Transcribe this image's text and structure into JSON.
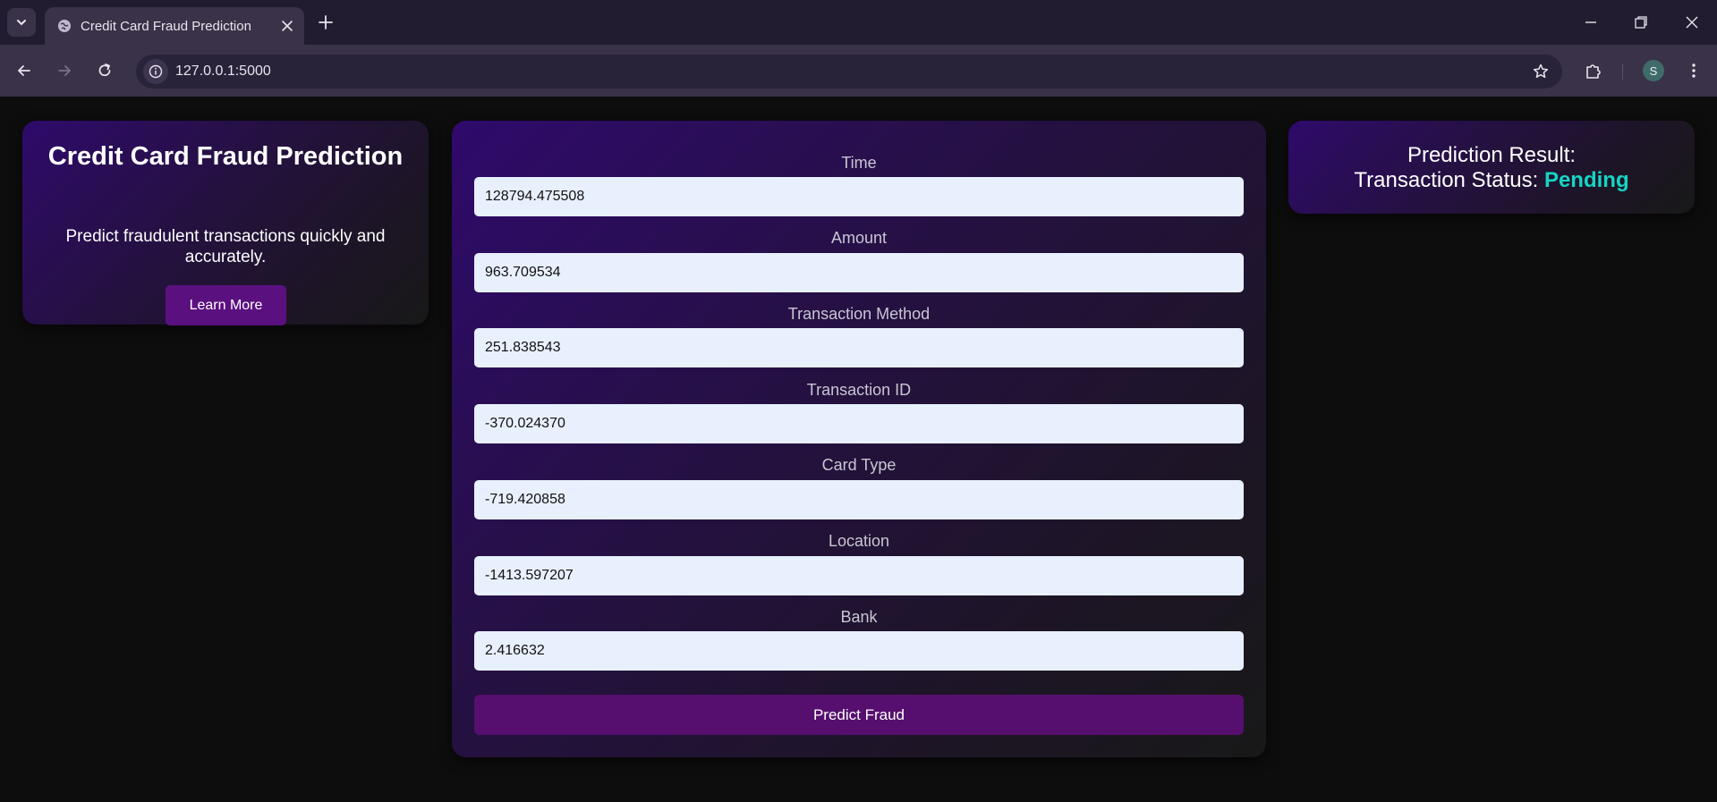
{
  "browser": {
    "tab_title": "Credit Card Fraud Prediction",
    "url": "127.0.0.1:5000",
    "profile_initial": "S"
  },
  "info": {
    "title": "Credit Card Fraud Prediction",
    "subtitle": "Predict fraudulent transactions quickly and accurately.",
    "button_label": "Learn More"
  },
  "form": {
    "fields": [
      {
        "label": "Time",
        "value": "128794.475508"
      },
      {
        "label": "Amount",
        "value": "963.709534"
      },
      {
        "label": "Transaction Method",
        "value": "251.838543"
      },
      {
        "label": "Transaction ID",
        "value": "-370.024370"
      },
      {
        "label": "Card Type",
        "value": "-719.420858"
      },
      {
        "label": "Location",
        "value": "-1413.597207"
      },
      {
        "label": "Bank",
        "value": "2.416632"
      }
    ],
    "submit_label": "Predict Fraud"
  },
  "result": {
    "title": "Prediction Result:",
    "status_label": "Transaction Status:",
    "status_value": "Pending",
    "status_color": "#16d4c4"
  },
  "colors": {
    "page_bg": "#0d0d0d",
    "card_gradient_start": "#2f0a6b",
    "button_purple": "#5b1080",
    "input_bg": "#e8f0fe"
  }
}
